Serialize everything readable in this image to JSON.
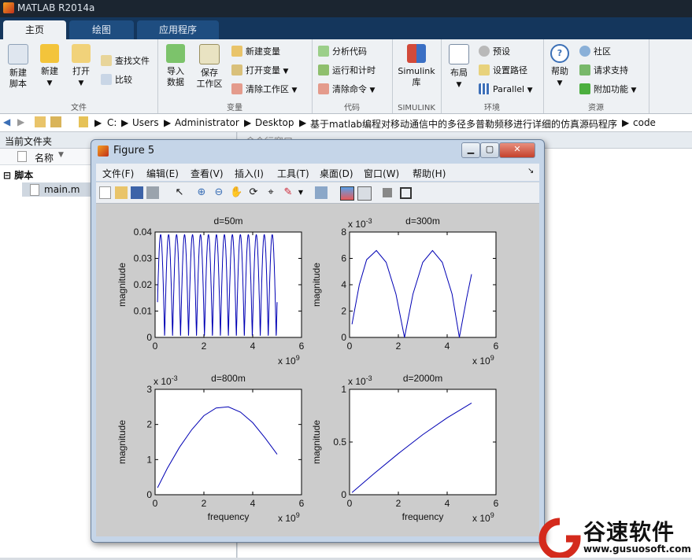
{
  "app": {
    "title": "MATLAB R2014a"
  },
  "tabs": [
    {
      "label": "主页"
    },
    {
      "label": "绘图"
    },
    {
      "label": "应用程序"
    }
  ],
  "ribbon": {
    "file": {
      "label": "文件",
      "new_script": "新建\n脚本",
      "new": "新建",
      "open": "打开",
      "find_files": "查找文件",
      "compare": "比较"
    },
    "variable": {
      "label": "变量",
      "import": "导入\n数据",
      "save_ws": "保存\n工作区",
      "new_var": "新建变量",
      "open_var": "打开变量",
      "clear_ws": "清除工作区"
    },
    "code": {
      "label": "代码",
      "analyze": "分析代码",
      "run_time": "运行和计时",
      "clear_cmd": "清除命令"
    },
    "simulink": {
      "label": "SIMULINK",
      "lib": "Simulink\n库"
    },
    "env": {
      "label": "环境",
      "layout": "布局",
      "prefs": "预设",
      "set_path": "设置路径",
      "parallel": "Parallel"
    },
    "resources": {
      "label": "资源",
      "help": "帮助",
      "community": "社区",
      "support": "请求支持",
      "addons": "附加功能"
    }
  },
  "address": {
    "crumbs": [
      "C:",
      "Users",
      "Administrator",
      "Desktop",
      "基于matlab编程对移动通信中的多径多普勒频移进行详细的仿真源码程序",
      "code"
    ]
  },
  "left_pane": {
    "title": "当前文件夹",
    "col_name": "名称",
    "folder": "脚本",
    "file": "main.m"
  },
  "right_pane": {
    "title": "命令行窗口"
  },
  "figure": {
    "title": "Figure 5",
    "menus": [
      "文件(F)",
      "编辑(E)",
      "查看(V)",
      "插入(I)",
      "工具(T)",
      "桌面(D)",
      "窗口(W)",
      "帮助(H)"
    ]
  },
  "chart_data": [
    {
      "type": "line",
      "title": "d=50m",
      "xlabel": "",
      "ylabel": "magnitude",
      "xlim": [
        0,
        6
      ],
      "ylim": [
        0,
        0.04
      ],
      "x_multiplier": "x 10^9",
      "y_multiplier": "",
      "xticks": [
        "0",
        "2",
        "4",
        "6"
      ],
      "yticks": [
        "0",
        "0.01",
        "0.02",
        "0.03",
        "0.04"
      ],
      "series": [
        {
          "x_range": [
            0.1,
            5.0
          ],
          "min": 0,
          "max": 0.039,
          "cycles": 15,
          "color": "#0000b4"
        }
      ]
    },
    {
      "type": "line",
      "title": "d=300m",
      "xlabel": "",
      "ylabel": "magnitude",
      "xlim": [
        0,
        6
      ],
      "ylim": [
        0,
        8
      ],
      "x_multiplier": "x 10^9",
      "y_multiplier": "x 10^-3",
      "xticks": [
        "0",
        "2",
        "4",
        "6"
      ],
      "yticks": [
        "0",
        "2",
        "4",
        "6",
        "8"
      ],
      "series": [
        {
          "x": [
            0.1,
            0.4,
            0.7,
            1.1,
            1.5,
            1.9,
            2.25,
            2.6,
            3.0,
            3.4,
            3.8,
            4.2,
            4.5,
            4.8,
            5.0
          ],
          "y": [
            1.0,
            4.0,
            5.9,
            6.6,
            5.7,
            3.3,
            0.0,
            3.3,
            5.7,
            6.6,
            5.7,
            3.3,
            0.0,
            3.0,
            4.8
          ],
          "color": "#0000b4"
        }
      ]
    },
    {
      "type": "line",
      "title": "d=800m",
      "xlabel": "frequency",
      "ylabel": "magnitude",
      "xlim": [
        0,
        6
      ],
      "ylim": [
        0,
        3
      ],
      "x_multiplier": "x 10^9",
      "y_multiplier": "x 10^-3",
      "xticks": [
        "0",
        "2",
        "4",
        "6"
      ],
      "yticks": [
        "0",
        "1",
        "2",
        "3"
      ],
      "series": [
        {
          "x": [
            0.1,
            0.5,
            1.0,
            1.5,
            2.0,
            2.5,
            3.0,
            3.5,
            4.0,
            4.5,
            5.0
          ],
          "y": [
            0.2,
            0.75,
            1.35,
            1.85,
            2.25,
            2.47,
            2.5,
            2.35,
            2.05,
            1.62,
            1.15
          ],
          "color": "#0000b4"
        }
      ]
    },
    {
      "type": "line",
      "title": "d=2000m",
      "xlabel": "frequency",
      "ylabel": "magnitude",
      "xlim": [
        0,
        6
      ],
      "ylim": [
        0,
        1
      ],
      "x_multiplier": "x 10^9",
      "y_multiplier": "x 10^-3",
      "xticks": [
        "0",
        "2",
        "4",
        "6"
      ],
      "yticks": [
        "0",
        "0.5",
        "1"
      ],
      "series": [
        {
          "x": [
            0.1,
            1.0,
            2.0,
            3.0,
            4.0,
            5.0
          ],
          "y": [
            0.02,
            0.2,
            0.39,
            0.57,
            0.73,
            0.87
          ],
          "color": "#0000b4"
        }
      ]
    }
  ],
  "watermark": {
    "cn": "谷速软件",
    "url": "www.gusuosoft.com",
    "color": "#d42a1c"
  }
}
